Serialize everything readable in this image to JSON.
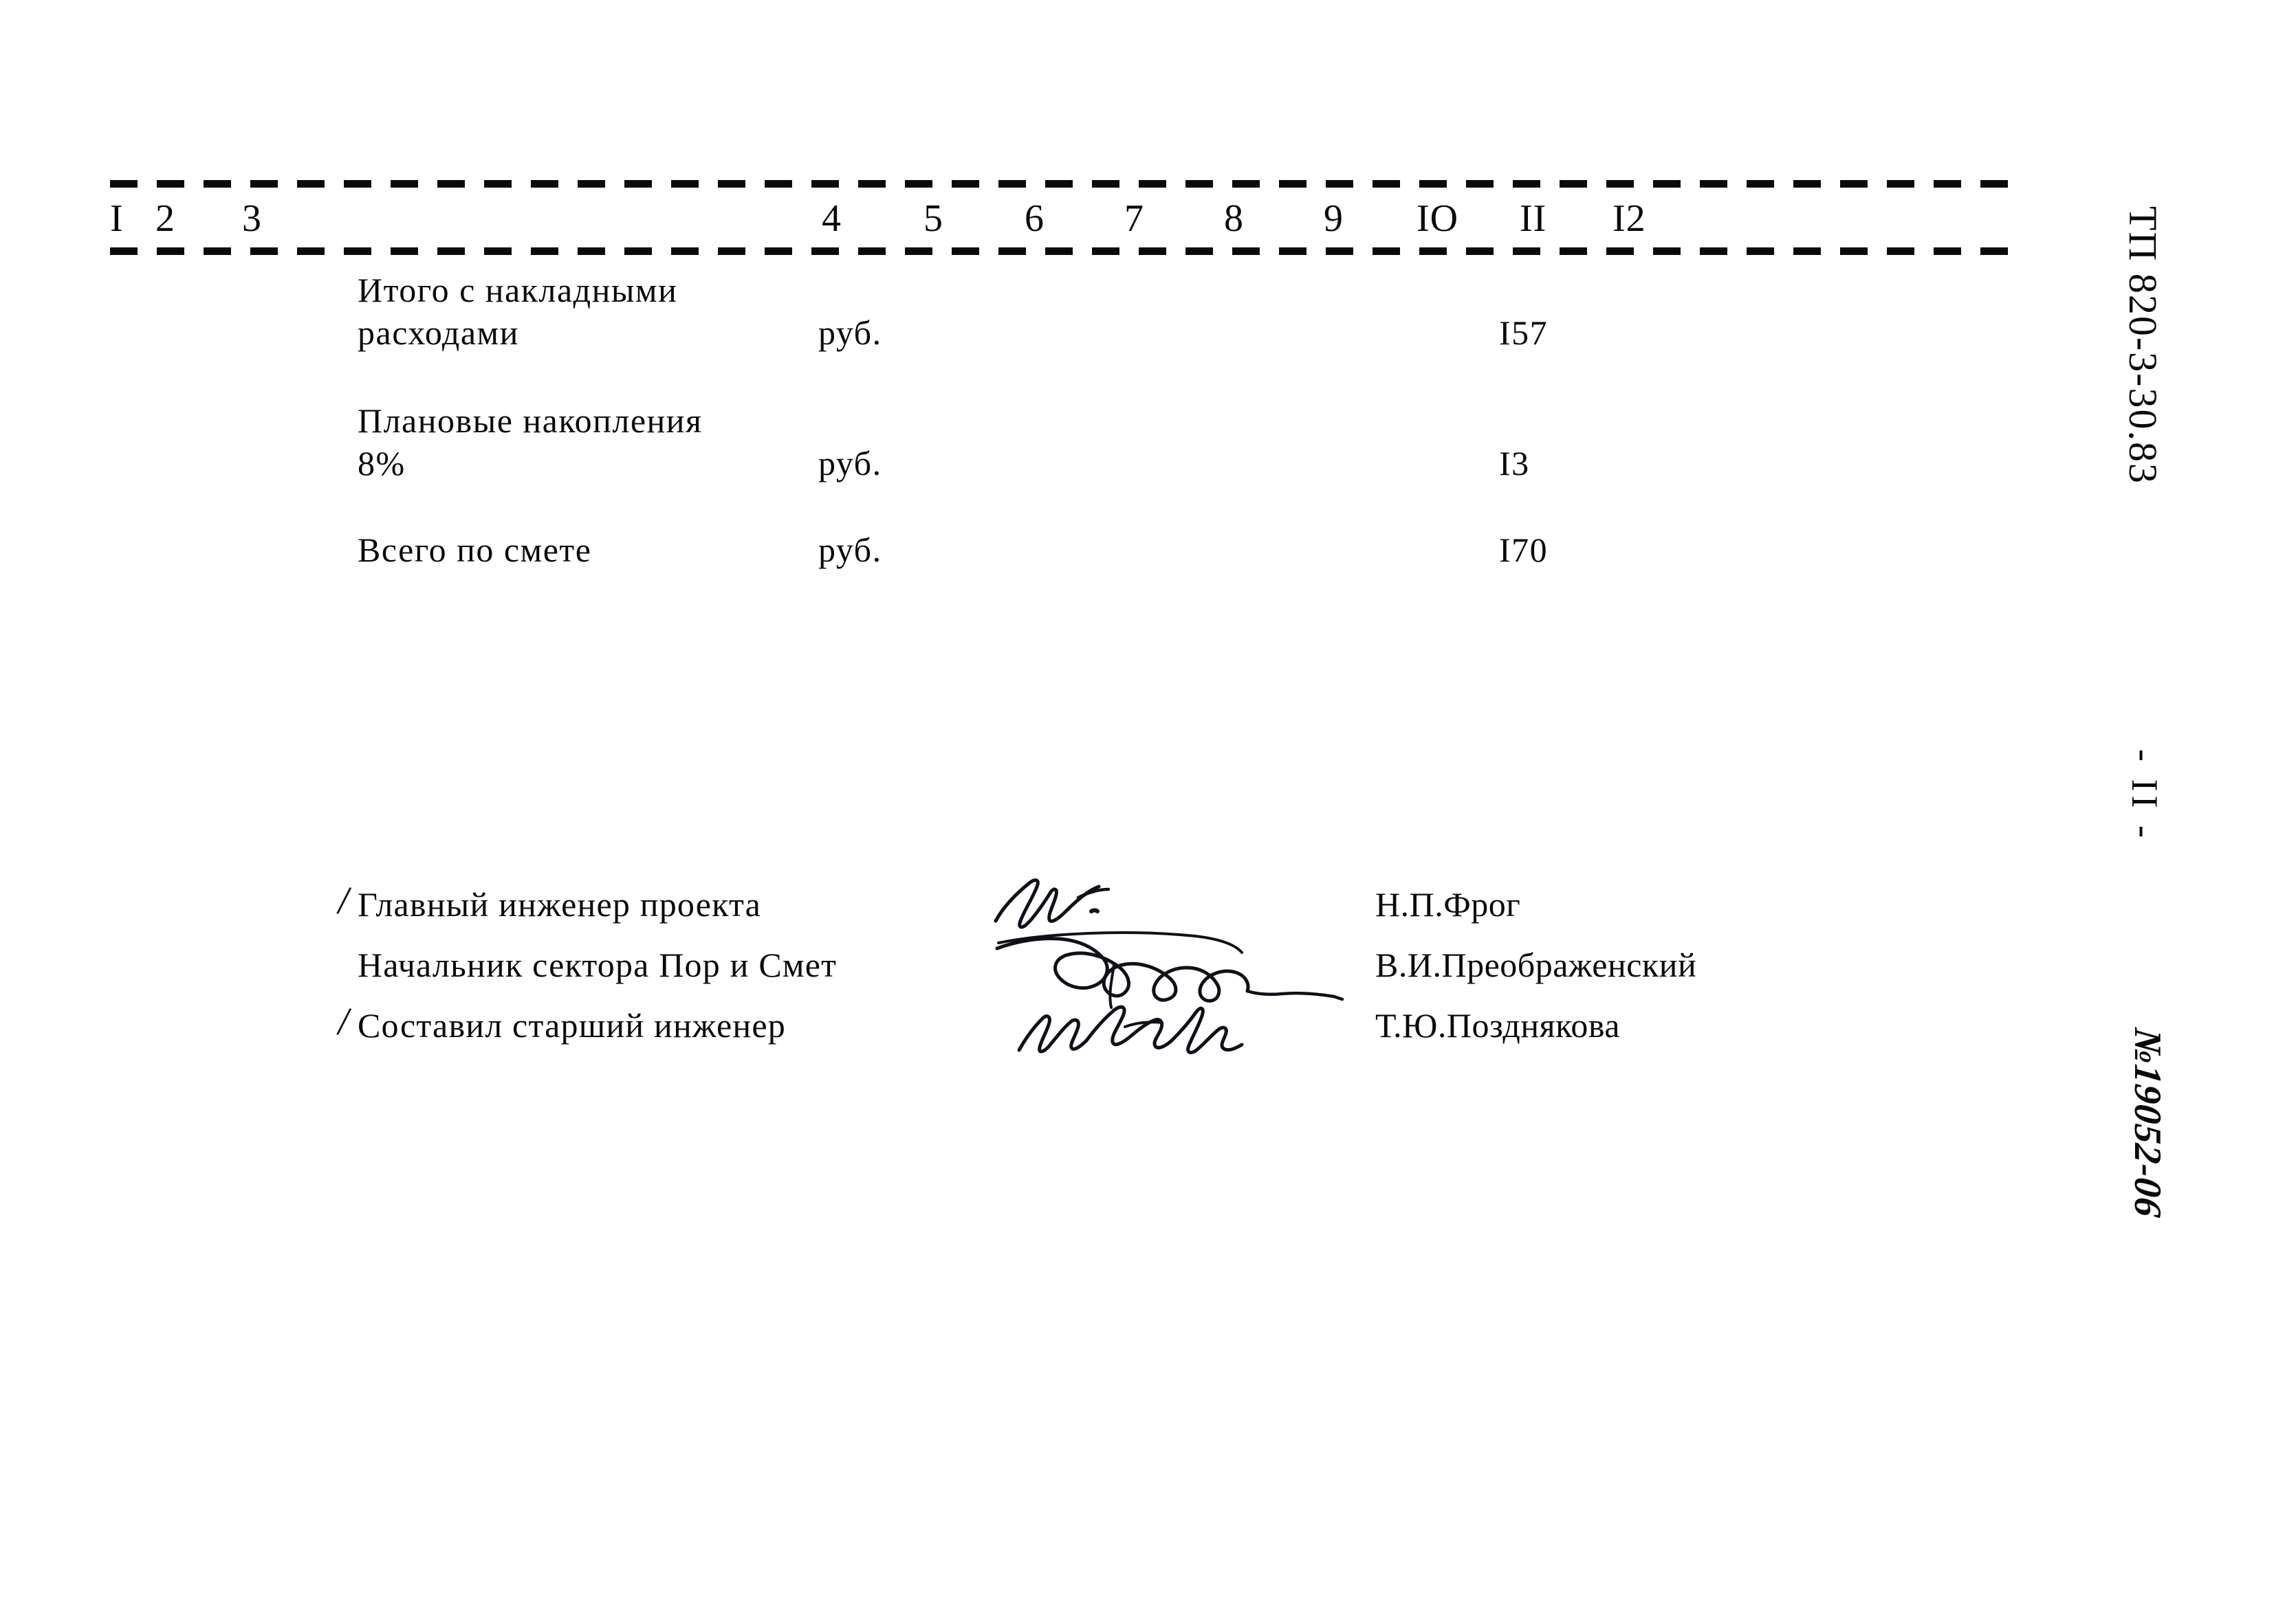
{
  "document": {
    "code": "ТП 820-3-30.83",
    "page_label": "- II -",
    "stamp_number": "№19052-06"
  },
  "table": {
    "column_numbers": [
      "I",
      "2",
      "3",
      "4",
      "5",
      "6",
      "7",
      "8",
      "9",
      "IO",
      "II",
      "I2"
    ],
    "rows": [
      {
        "name_line1": "Итого с накладными",
        "name_line2": "расходами",
        "unit": "руб.",
        "value": "I57"
      },
      {
        "name_line1": "Плановые накопления",
        "name_line2": "8%",
        "unit": "руб.",
        "value": "I3"
      },
      {
        "name_line1": "Всего по смете",
        "name_line2": "",
        "unit": "руб.",
        "value": "I70"
      }
    ]
  },
  "signatures": {
    "slash": "/",
    "rows": [
      {
        "title": "Главный инженер проекта",
        "name": "Н.П.Фрог",
        "has_slash": true
      },
      {
        "title": "Начальник сектора Пор и Смет",
        "name": "В.И.Преображенский",
        "has_slash": false
      },
      {
        "title": "Составил старший инженер",
        "name": "Т.Ю.Позднякова",
        "has_slash": true
      }
    ]
  },
  "colors": {
    "ink": "#0a0a0a",
    "paper": "#ffffff",
    "signature_ink": "#101018"
  }
}
